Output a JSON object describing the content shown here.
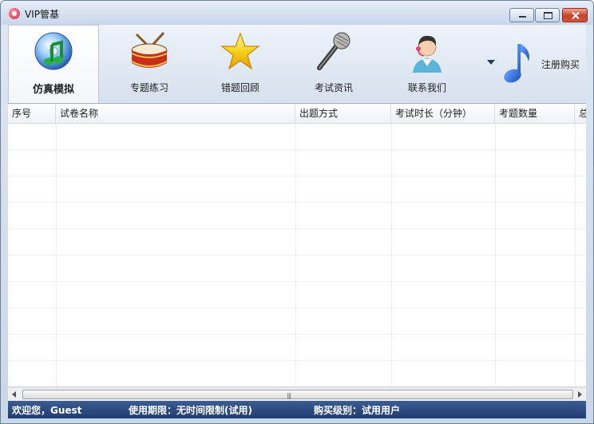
{
  "window": {
    "title": "VIP管基"
  },
  "toolbar": {
    "items": [
      {
        "label": "仿真模拟",
        "icon": "cd-music-icon"
      },
      {
        "label": "专题练习",
        "icon": "drum-icon"
      },
      {
        "label": "错题回顾",
        "icon": "star-icon"
      },
      {
        "label": "考试资讯",
        "icon": "microphone-icon"
      },
      {
        "label": "联系我们",
        "icon": "contact-person-icon"
      }
    ],
    "register_label": "注册购买"
  },
  "table": {
    "columns": [
      "序号",
      "试卷名称",
      "出题方式",
      "考试时长（分钟）",
      "考题数量",
      "总"
    ],
    "rows": []
  },
  "status": {
    "welcome": "欢迎您，Guest",
    "period": "使用期限：无时间限制(试用)",
    "level": "购买级别：试用用户"
  },
  "colors": {
    "statusbar": "#2a4a80",
    "titlebar": "#d3e0ef"
  }
}
